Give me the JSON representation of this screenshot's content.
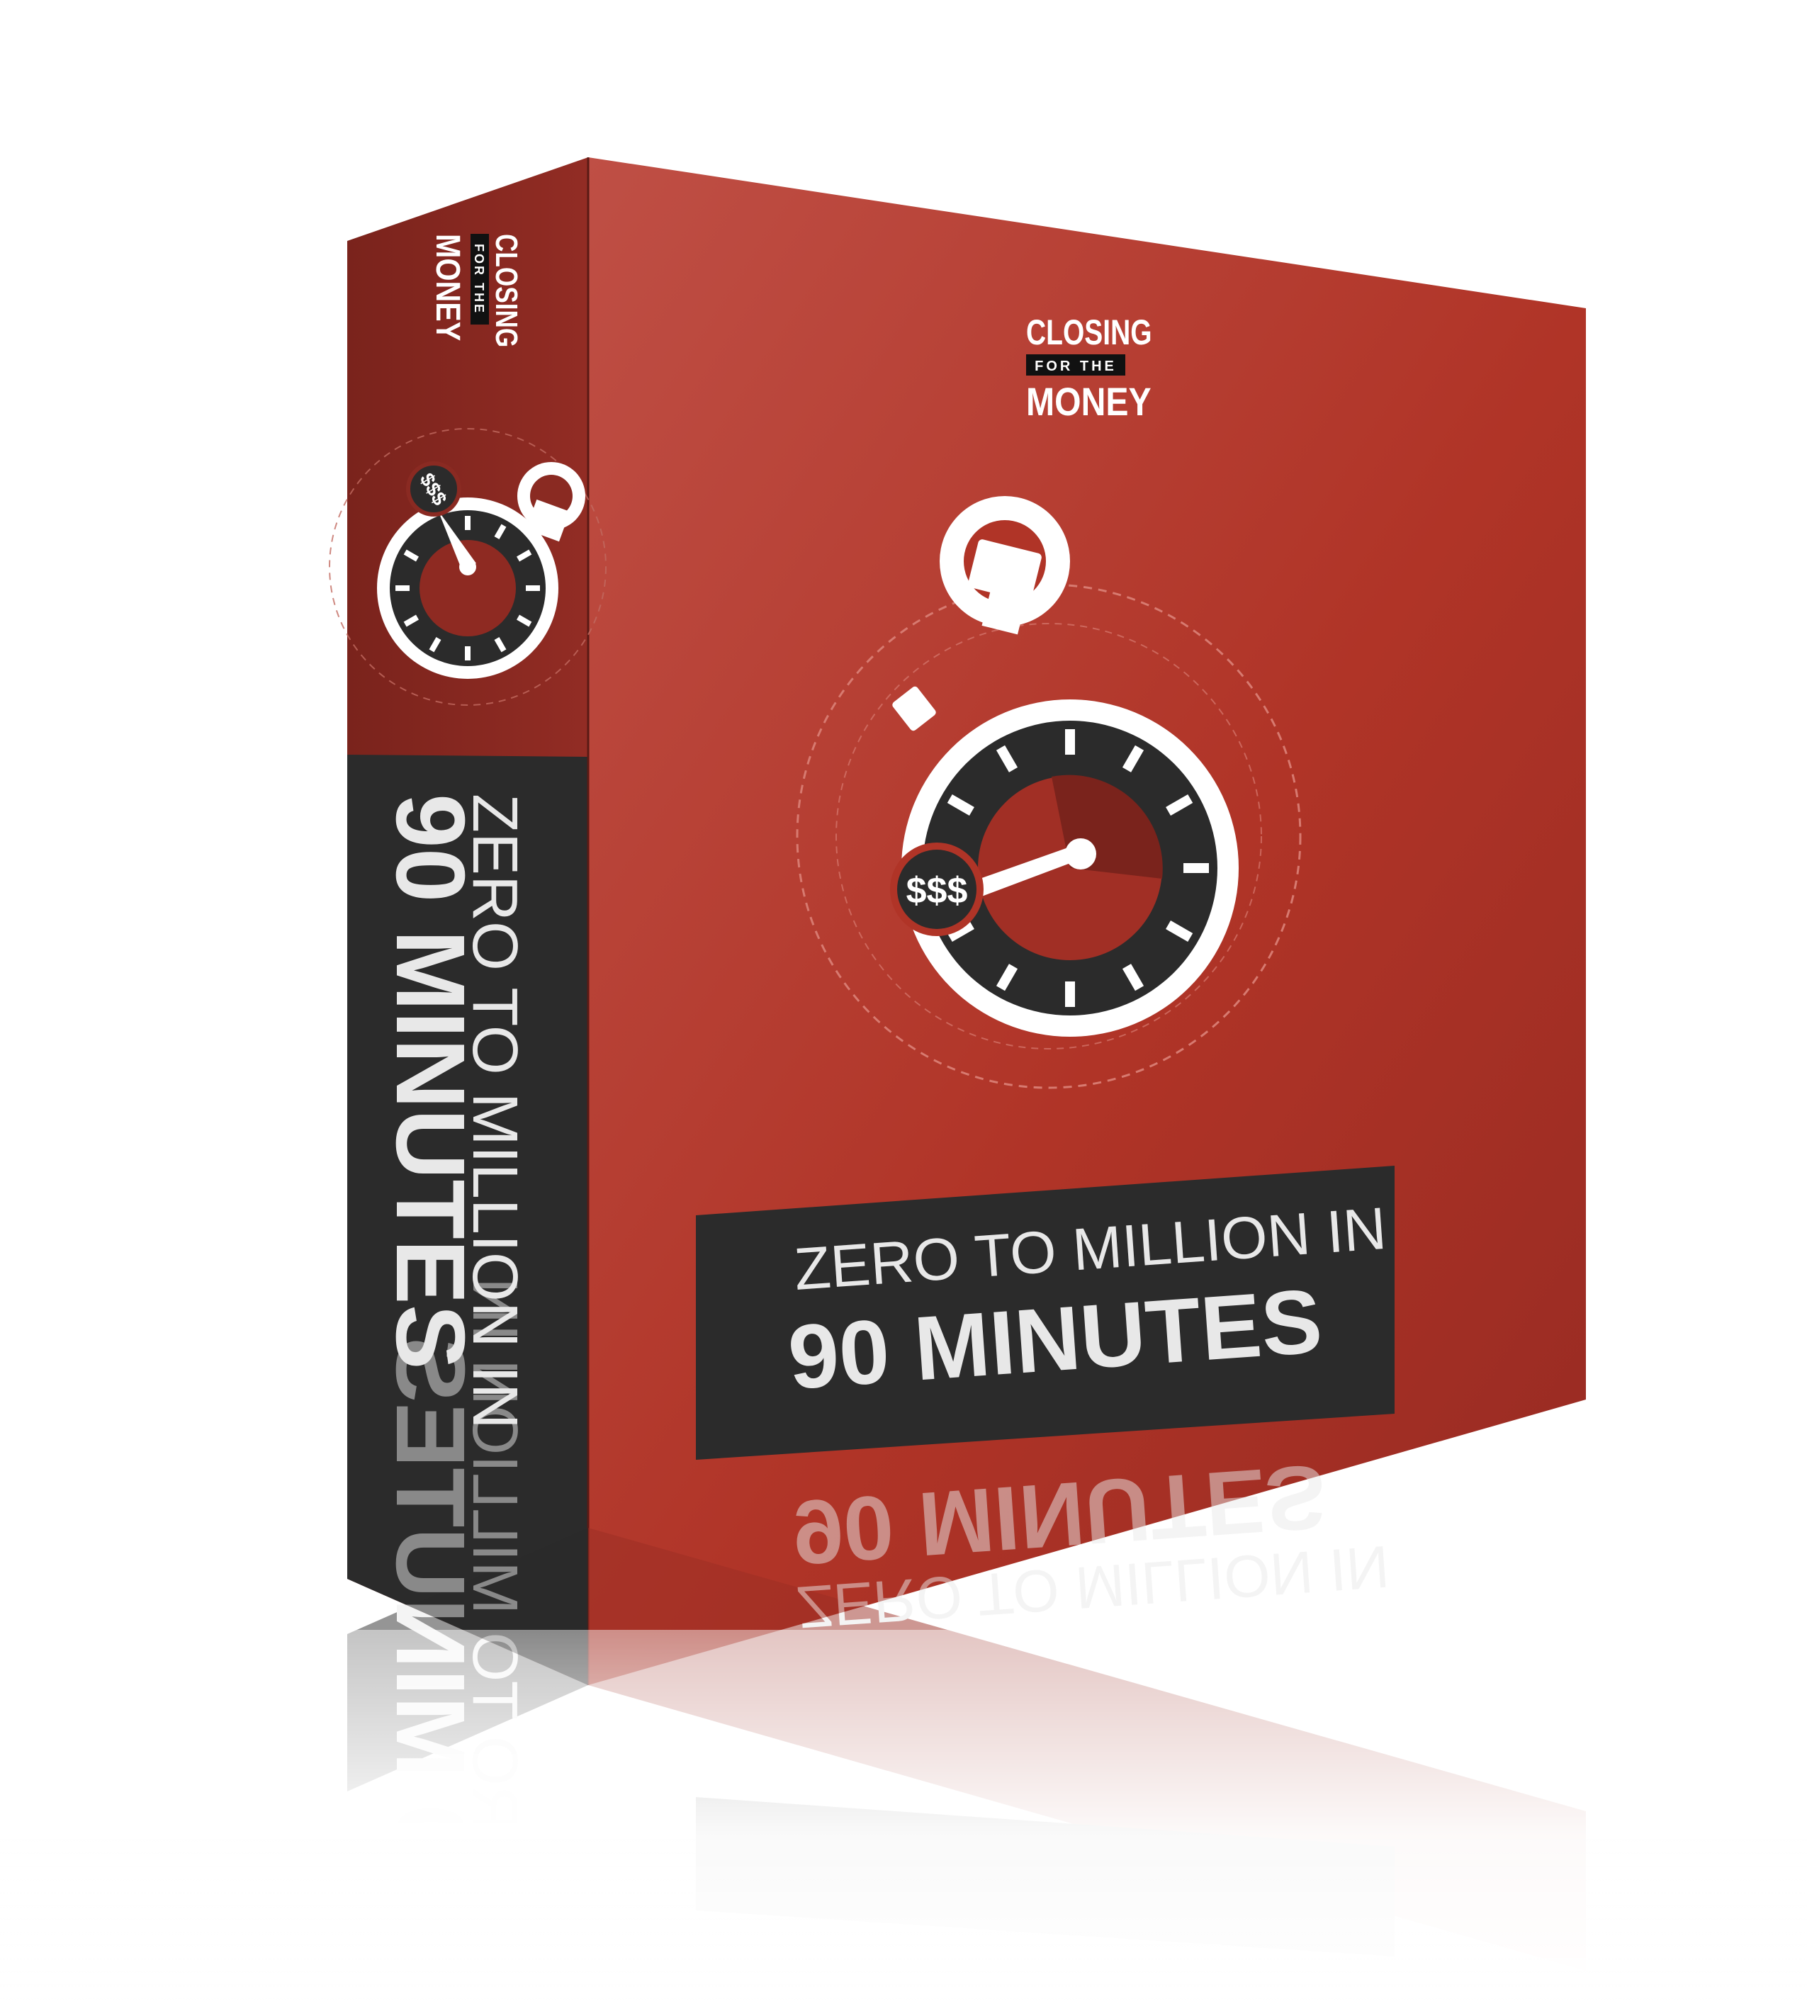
{
  "product": {
    "brand": {
      "line1": "CLOSING",
      "line2": "FOR THE",
      "line3": "MONEY"
    },
    "title_line1": "ZERO TO MILLION IN",
    "title_line2": "90 MINUTES",
    "stopwatch_badge": "$$$"
  },
  "colors": {
    "box_red": "#b23a2f",
    "box_red_dark": "#8a2a22",
    "panel_dark": "#2a2a2a",
    "text_light": "#e8e8e8"
  }
}
